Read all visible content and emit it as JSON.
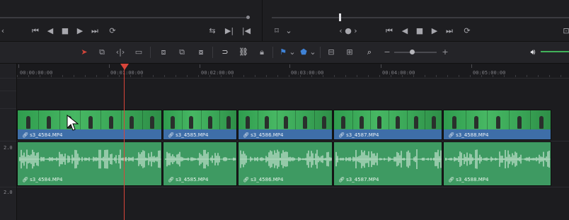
{
  "viewer": {
    "left_controls": [
      "first-frame-icon",
      "step-back-icon",
      "stop-icon",
      "play-icon",
      "last-frame-icon",
      "loop-icon"
    ],
    "right_controls": [
      "first-frame-icon",
      "step-back-icon",
      "stop-icon",
      "play-icon",
      "last-frame-icon",
      "loop-icon"
    ]
  },
  "toolbar": {
    "zoom_minus": "−",
    "zoom_plus": "+"
  },
  "ruler": {
    "ticks": [
      "00:00:00:00",
      "00:01:00:00",
      "00:02:00:00",
      "00:03:00:00",
      "00:04:00:00",
      "00:05:00:00"
    ]
  },
  "track_labels": {
    "a1": "2.0",
    "a2": "2.0"
  },
  "video_clips": [
    {
      "name": "s3_4584.MP4"
    },
    {
      "name": "s3_4585.MP4"
    },
    {
      "name": "s3_4586.MP4"
    },
    {
      "name": "s3_4587.MP4"
    },
    {
      "name": "s3_4588.MP4"
    }
  ],
  "audio_clips": [
    {
      "name": "s3_4584.MP4"
    },
    {
      "name": "s3_4585.MP4"
    },
    {
      "name": "s3_4586.MP4"
    },
    {
      "name": "s3_4587.MP4"
    },
    {
      "name": "s3_4588.MP4"
    }
  ],
  "colors": {
    "video_clip": "#3e6ea8",
    "audio_clip": "#3e9a62",
    "playhead": "#d8453a",
    "volume": "#42b25a"
  }
}
